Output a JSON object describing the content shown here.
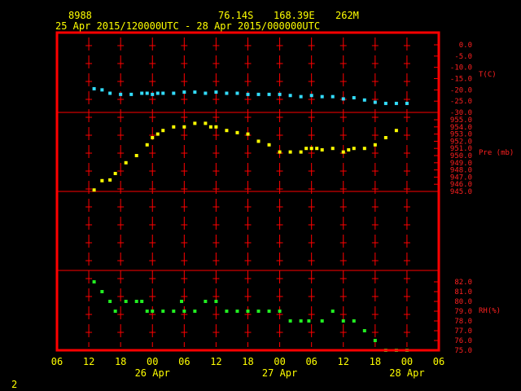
{
  "header": {
    "station_id": "8988",
    "latitude": "76.14S",
    "longitude": "168.39E",
    "elevation": "262M",
    "date_range": "25 Apr 2015/120000UTC - 28 Apr 2015/000000UTC",
    "footer_number": "2"
  },
  "colors": {
    "background": "#000000",
    "frame": "#ff0000",
    "grid": "#ff0000",
    "text": "#ffff00",
    "temperature": "#33ddff",
    "pressure": "#ffff00",
    "humidity": "#22ee22"
  },
  "chart_data": {
    "type": "scatter",
    "x_axis": {
      "unit": "hours from 25 Apr 2015 06UTC",
      "range": [
        0,
        72
      ],
      "tick_labels": [
        "06",
        "12",
        "18",
        "00",
        "06",
        "12",
        "18",
        "00",
        "06",
        "12",
        "18",
        "00",
        "06"
      ],
      "date_labels": [
        {
          "text": "26 Apr",
          "hour": 18
        },
        {
          "text": "27 Apr",
          "hour": 42
        },
        {
          "text": "28 Apr",
          "hour": 66
        }
      ]
    },
    "panels": [
      {
        "name": "T(C)",
        "color": "#33ddff",
        "ylim": [
          -30.0,
          0.0
        ],
        "tick_labels": [
          "0.0",
          "-5.0",
          "-10.0",
          "-15.0",
          "-20.0",
          "-25.0",
          "-30.0"
        ],
        "x": [
          7,
          8.5,
          10,
          12,
          14,
          16,
          17,
          18,
          19,
          20,
          22,
          24,
          26,
          28,
          30,
          32,
          34,
          36,
          38,
          40,
          42,
          44,
          46,
          48,
          50,
          52,
          54,
          56,
          58,
          60,
          62,
          64,
          66
        ],
        "values": [
          -19.5,
          -20.0,
          -21.5,
          -22.0,
          -22.0,
          -21.5,
          -21.5,
          -22.0,
          -21.5,
          -21.5,
          -21.5,
          -21.0,
          -21.0,
          -21.5,
          -21.0,
          -21.5,
          -21.5,
          -22.0,
          -22.0,
          -22.0,
          -22.0,
          -22.5,
          -23.0,
          -22.5,
          -23.0,
          -23.0,
          -24.0,
          -23.5,
          -24.5,
          -25.5,
          -26.0,
          -26.0,
          -26.0
        ]
      },
      {
        "name": "Pre (mb)",
        "color": "#ffff00",
        "ylim": [
          945.0,
          955.0
        ],
        "tick_labels": [
          "955.0",
          "954.0",
          "953.0",
          "952.0",
          "951.0",
          "950.0",
          "949.0",
          "948.0",
          "947.0",
          "946.0",
          "945.0"
        ],
        "x": [
          7,
          8.5,
          10,
          11,
          13,
          15,
          17,
          18,
          19,
          20,
          22,
          24,
          26,
          28,
          29,
          30,
          32,
          34,
          36,
          38,
          40,
          42,
          44,
          46,
          47,
          48,
          49,
          50,
          52,
          54,
          55,
          56,
          58,
          60,
          62,
          64
        ],
        "values": [
          945.2,
          946.5,
          946.6,
          947.5,
          949.0,
          950.0,
          951.5,
          952.5,
          953.0,
          953.5,
          954.0,
          954.0,
          954.5,
          954.5,
          954.0,
          954.0,
          953.5,
          953.2,
          953.0,
          952.0,
          951.5,
          950.5,
          950.5,
          950.5,
          951.0,
          951.0,
          951.0,
          950.8,
          951.0,
          950.5,
          950.8,
          951.0,
          951.0,
          951.5,
          952.5,
          953.5
        ]
      },
      {
        "name": "RH(%)",
        "color": "#22ee22",
        "ylim": [
          75.0,
          82.0
        ],
        "tick_labels": [
          "82.0",
          "81.0",
          "80.0",
          "79.0",
          "78.0",
          "77.0",
          "76.0",
          "75.0"
        ],
        "x": [
          7,
          8.5,
          10,
          11,
          13,
          15,
          16,
          17,
          18,
          20,
          22,
          24,
          23.5,
          26,
          28,
          30,
          32,
          34,
          36,
          38,
          40,
          42,
          44,
          46,
          47.5,
          50,
          52,
          54,
          56,
          58,
          60,
          62,
          64,
          66
        ],
        "values": [
          82.0,
          81.0,
          80.0,
          79.0,
          80.0,
          80.0,
          80.0,
          79.0,
          79.0,
          79.0,
          79.0,
          79.0,
          80.0,
          79.0,
          80.0,
          80.0,
          79.0,
          79.0,
          79.0,
          79.0,
          79.0,
          79.0,
          78.0,
          78.0,
          78.0,
          78.0,
          79.0,
          78.0,
          78.0,
          77.0,
          76.0,
          75.0,
          75.0,
          75.0
        ]
      }
    ]
  }
}
